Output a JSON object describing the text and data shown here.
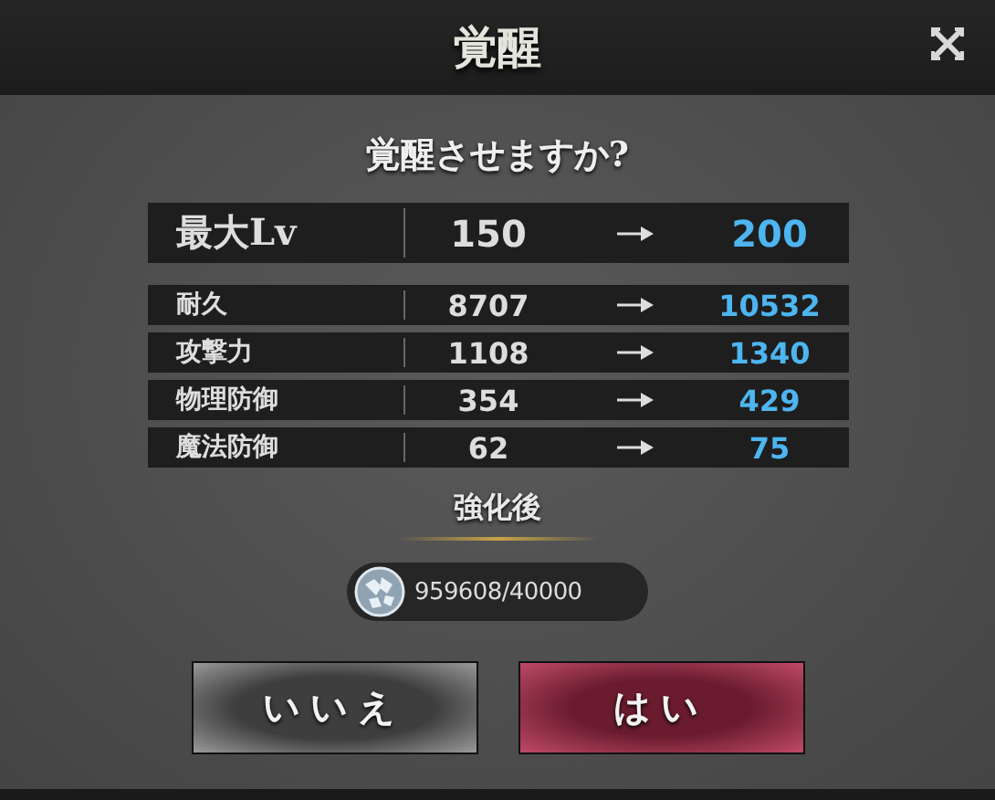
{
  "window": {
    "title": "覚醒"
  },
  "question": "覚醒させますか?",
  "level": {
    "label": "最大Lv",
    "current": "150",
    "next": "200"
  },
  "stats": [
    {
      "label": "耐久",
      "current": "8707",
      "next": "10532"
    },
    {
      "label": "攻撃力",
      "current": "1108",
      "next": "1340"
    },
    {
      "label": "物理防御",
      "current": "354",
      "next": "429"
    },
    {
      "label": "魔法防御",
      "current": "62",
      "next": "75"
    }
  ],
  "section": "強化後",
  "cost": "959608/40000",
  "buttons": [
    {
      "label": "いいえ",
      "kind": "cancel"
    },
    {
      "label": "はい",
      "kind": "confirm"
    }
  ]
}
